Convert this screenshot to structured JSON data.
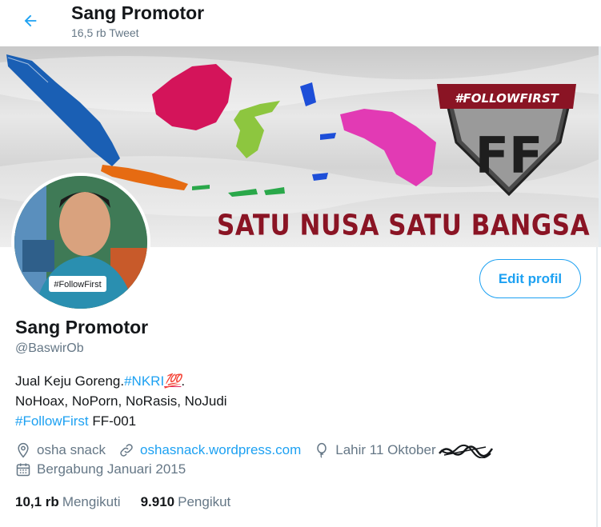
{
  "header": {
    "name": "Sang Promotor",
    "tweet_count": "16,5 rb Tweet",
    "back_icon": "arrow-left-icon"
  },
  "banner": {
    "slogan": "SATU NUSA SATU BANGSA",
    "logo_text": "#FOLLOWFIRST",
    "logo_letters": "FF"
  },
  "avatar": {
    "badge": "#FollowFirst"
  },
  "profile": {
    "name": "Sang Promotor",
    "handle": "@BaswirOb",
    "edit_button": "Edit profil"
  },
  "bio": {
    "line1_text": "Jual Keju Goreng.",
    "line1_hashtag": "#NKRI",
    "line1_emoji": "💯",
    "line1_end": ".",
    "line2": "NoHoax, NoPorn, NoRasis, NoJudi",
    "line3_hashtag": "#FollowFirst",
    "line3_text": " FF-001"
  },
  "meta": {
    "location": "osha snack",
    "website": "oshasnack.wordpress.com",
    "birthday": "Lahir 11 Oktober",
    "joined": "Bergabung Januari 2015"
  },
  "stats": {
    "following_count": "10,1 rb",
    "following_label": "Mengikuti",
    "followers_count": "9.910",
    "followers_label": "Pengikut"
  },
  "colors": {
    "accent": "#1da1f2",
    "secondary_text": "#657786",
    "slogan": "#8a1424"
  }
}
